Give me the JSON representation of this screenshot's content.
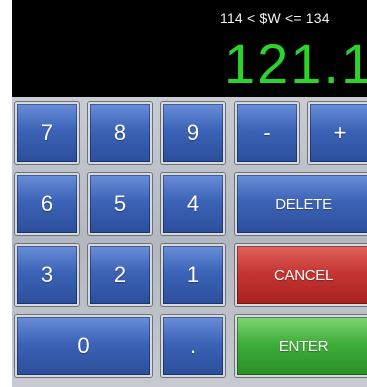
{
  "display": {
    "range_text": "114 < $W <= 134",
    "value_text": "121.1",
    "value_color": "#2bd42b"
  },
  "keys": {
    "seven": "7",
    "eight": "8",
    "nine": "9",
    "minus": "-",
    "plus": "+",
    "six": "6",
    "five": "5",
    "four": "4",
    "delete": "DELETE",
    "three": "3",
    "two": "2",
    "one": "1",
    "cancel": "CANCEL",
    "zero": "0",
    "decimal": ".",
    "enter": "ENTER"
  },
  "colors": {
    "key_blue": "#3c63b7",
    "cancel_red": "#c53633",
    "enter_green": "#3fae39",
    "display_bg": "#000000"
  }
}
